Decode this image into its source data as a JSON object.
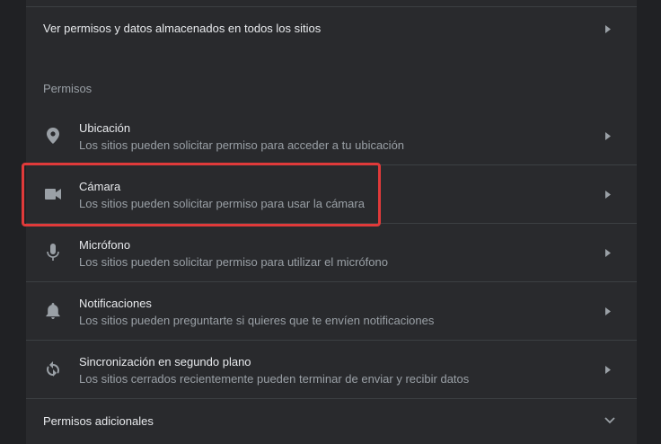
{
  "all_sites": {
    "label": "Ver permisos y datos almacenados en todos los sitios"
  },
  "permissions": {
    "heading": "Permisos",
    "items": [
      {
        "title": "Ubicación",
        "subtitle": "Los sitios pueden solicitar permiso para acceder a tu ubicación",
        "icon": "location-pin-icon"
      },
      {
        "title": "Cámara",
        "subtitle": "Los sitios pueden solicitar permiso para usar la cámara",
        "icon": "videocam-icon"
      },
      {
        "title": "Micrófono",
        "subtitle": "Los sitios pueden solicitar permiso para utilizar el micrófono",
        "icon": "microphone-icon"
      },
      {
        "title": "Notificaciones",
        "subtitle": "Los sitios pueden preguntarte si quieres que te envíen notificaciones",
        "icon": "bell-icon"
      },
      {
        "title": "Sincronización en segundo plano",
        "subtitle": "Los sitios cerrados recientemente pueden terminar de enviar y recibir datos",
        "icon": "sync-icon"
      }
    ]
  },
  "additional_permissions": {
    "label": "Permisos adicionales"
  },
  "colors": {
    "background": "#202124",
    "card": "#292a2d",
    "highlight_border": "#e03a3a"
  }
}
